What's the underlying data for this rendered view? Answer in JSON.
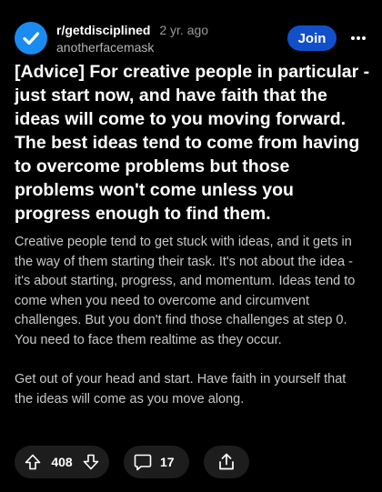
{
  "post": {
    "subreddit": "r/getdisciplined",
    "age": "2 yr. ago",
    "author": "anotherfacemask",
    "join_label": "Join",
    "title": "[Advice] For creative people in particular - just start now, and have faith that the ideas will come to you moving forward. The best ideas tend to come from having to overcome problems but those problems won't come unless you progress enough to find them.",
    "paragraphs": [
      "Creative people tend to get stuck with ideas, and it gets in the way of them starting their task. It's not about the idea - it's about starting, progress, and momentum. Ideas tend to come when you need to overcome and circumvent challenges. But you don't find those challenges at step 0. You need to face them realtime as they occur.",
      "Get out of your head and start. Have faith in yourself that the ideas will come as you move along."
    ]
  },
  "actions": {
    "upvotes": "408",
    "comments": "17"
  },
  "icons": {
    "avatar": "checkmark-badge-icon",
    "more": "more-horizontal-icon",
    "upvote": "arrow-up-icon",
    "downvote": "arrow-down-icon",
    "comment": "comment-bubble-icon",
    "share": "share-icon"
  },
  "colors": {
    "background": "#000000",
    "avatar": "#1a8cf0",
    "join_button": "#1250c9",
    "pill": "#1d1d1d",
    "body_text": "#c8c8c8",
    "meta_text": "#9a9a9a"
  }
}
